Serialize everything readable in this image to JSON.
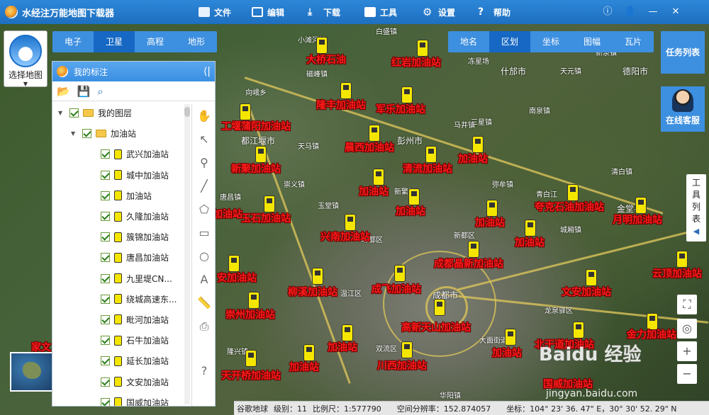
{
  "app": {
    "title": "水经注万能地图下载器"
  },
  "menu": [
    {
      "label": "文件",
      "icon": "folder-icon"
    },
    {
      "label": "编辑",
      "icon": "edit-icon"
    },
    {
      "label": "下载",
      "icon": "download-icon"
    },
    {
      "label": "工具",
      "icon": "toolbox-icon"
    },
    {
      "label": "设置",
      "icon": "gear-icon"
    },
    {
      "label": "帮助",
      "icon": "help-icon"
    }
  ],
  "window_controls": {
    "info": "ⓘ",
    "user": "👤",
    "minimize": "—",
    "close": "✕"
  },
  "select_map": {
    "label": "选择地图"
  },
  "map_type_tabs": [
    {
      "label": "电子",
      "active": false
    },
    {
      "label": "卫星",
      "active": true
    },
    {
      "label": "高程",
      "active": false
    },
    {
      "label": "地形",
      "active": false
    }
  ],
  "overlay_tabs": [
    {
      "label": "地名",
      "active": false
    },
    {
      "label": "区划",
      "active": true
    },
    {
      "label": "坐标",
      "active": false
    },
    {
      "label": "图幅",
      "active": false
    },
    {
      "label": "瓦片",
      "active": false
    }
  ],
  "right_buttons": {
    "task_list": "任务列表",
    "online_service": "在线客服",
    "tool_list": "工具列表"
  },
  "zoom": {
    "plus": "+",
    "minus": "−"
  },
  "panel": {
    "title": "我的标注",
    "tree": {
      "root": "我的图层",
      "group": "加油站",
      "items": [
        "武兴加油站",
        "城中加油站",
        "加油站",
        "久隆加油站",
        "簇锦加油站",
        "唐昌加油站",
        "九里堤CN...",
        "绕城高速东...",
        "毗河加油站",
        "石牛加油站",
        "延长加油站",
        "文安加油站",
        "国威加油站"
      ]
    }
  },
  "map": {
    "stations": [
      "大桥石油",
      "红岩加油站",
      "隆丰加油站",
      "军乐加油站",
      "工堰蒲阳加油站",
      "晨西加油站",
      "新聚加油站",
      "清流加油站",
      "加油站",
      "加油站",
      "加油站",
      "玉石加油站",
      "加油站",
      "加油站",
      "兴南加油站",
      "夸克石油加油站",
      "月明加油站",
      "加油站",
      "成都晶新加油站",
      "安加油站",
      "柳溪加油站",
      "成飞加油站",
      "文安加油站",
      "云顶加油站",
      "崇州加油站",
      "高新天山加油站",
      "金力加油站",
      "加油站",
      "加油站",
      "北干道加油站",
      "川西加油站",
      "天开桥加油站",
      "加油站",
      "国威加油站",
      "家文"
    ],
    "places": [
      "小滩河镇",
      "白盛镇",
      "磁峰镇",
      "冻星场",
      "新泉镇",
      "德阳市",
      "什邡市",
      "天元镇",
      "向峨乡",
      "马井镇",
      "南泉镇",
      "都江堰市",
      "彭州市",
      "天马镇",
      "三星镇",
      "新繁镇",
      "崇义镇",
      "唐昌镇",
      "青白江",
      "弥牟镇",
      "金堂县",
      "玉堂镇",
      "城厢镇",
      "清白镇",
      "温江区",
      "成都市",
      "郫都区",
      "新都区",
      "双流区",
      "龙泉驿区",
      "大面街道",
      "华阳镇",
      "隆兴镇"
    ]
  },
  "status": {
    "source": "谷歌地球",
    "level": "级别：11",
    "scale": "比例尺：1:577790",
    "resolution": "空间分辨率：152.874057",
    "coords": "坐标：104° 23' 36. 47\" E，30° 30' 52. 29\" N"
  },
  "watermark": {
    "text": "Baidu 经验",
    "url": "jingyan.baidu.com"
  }
}
